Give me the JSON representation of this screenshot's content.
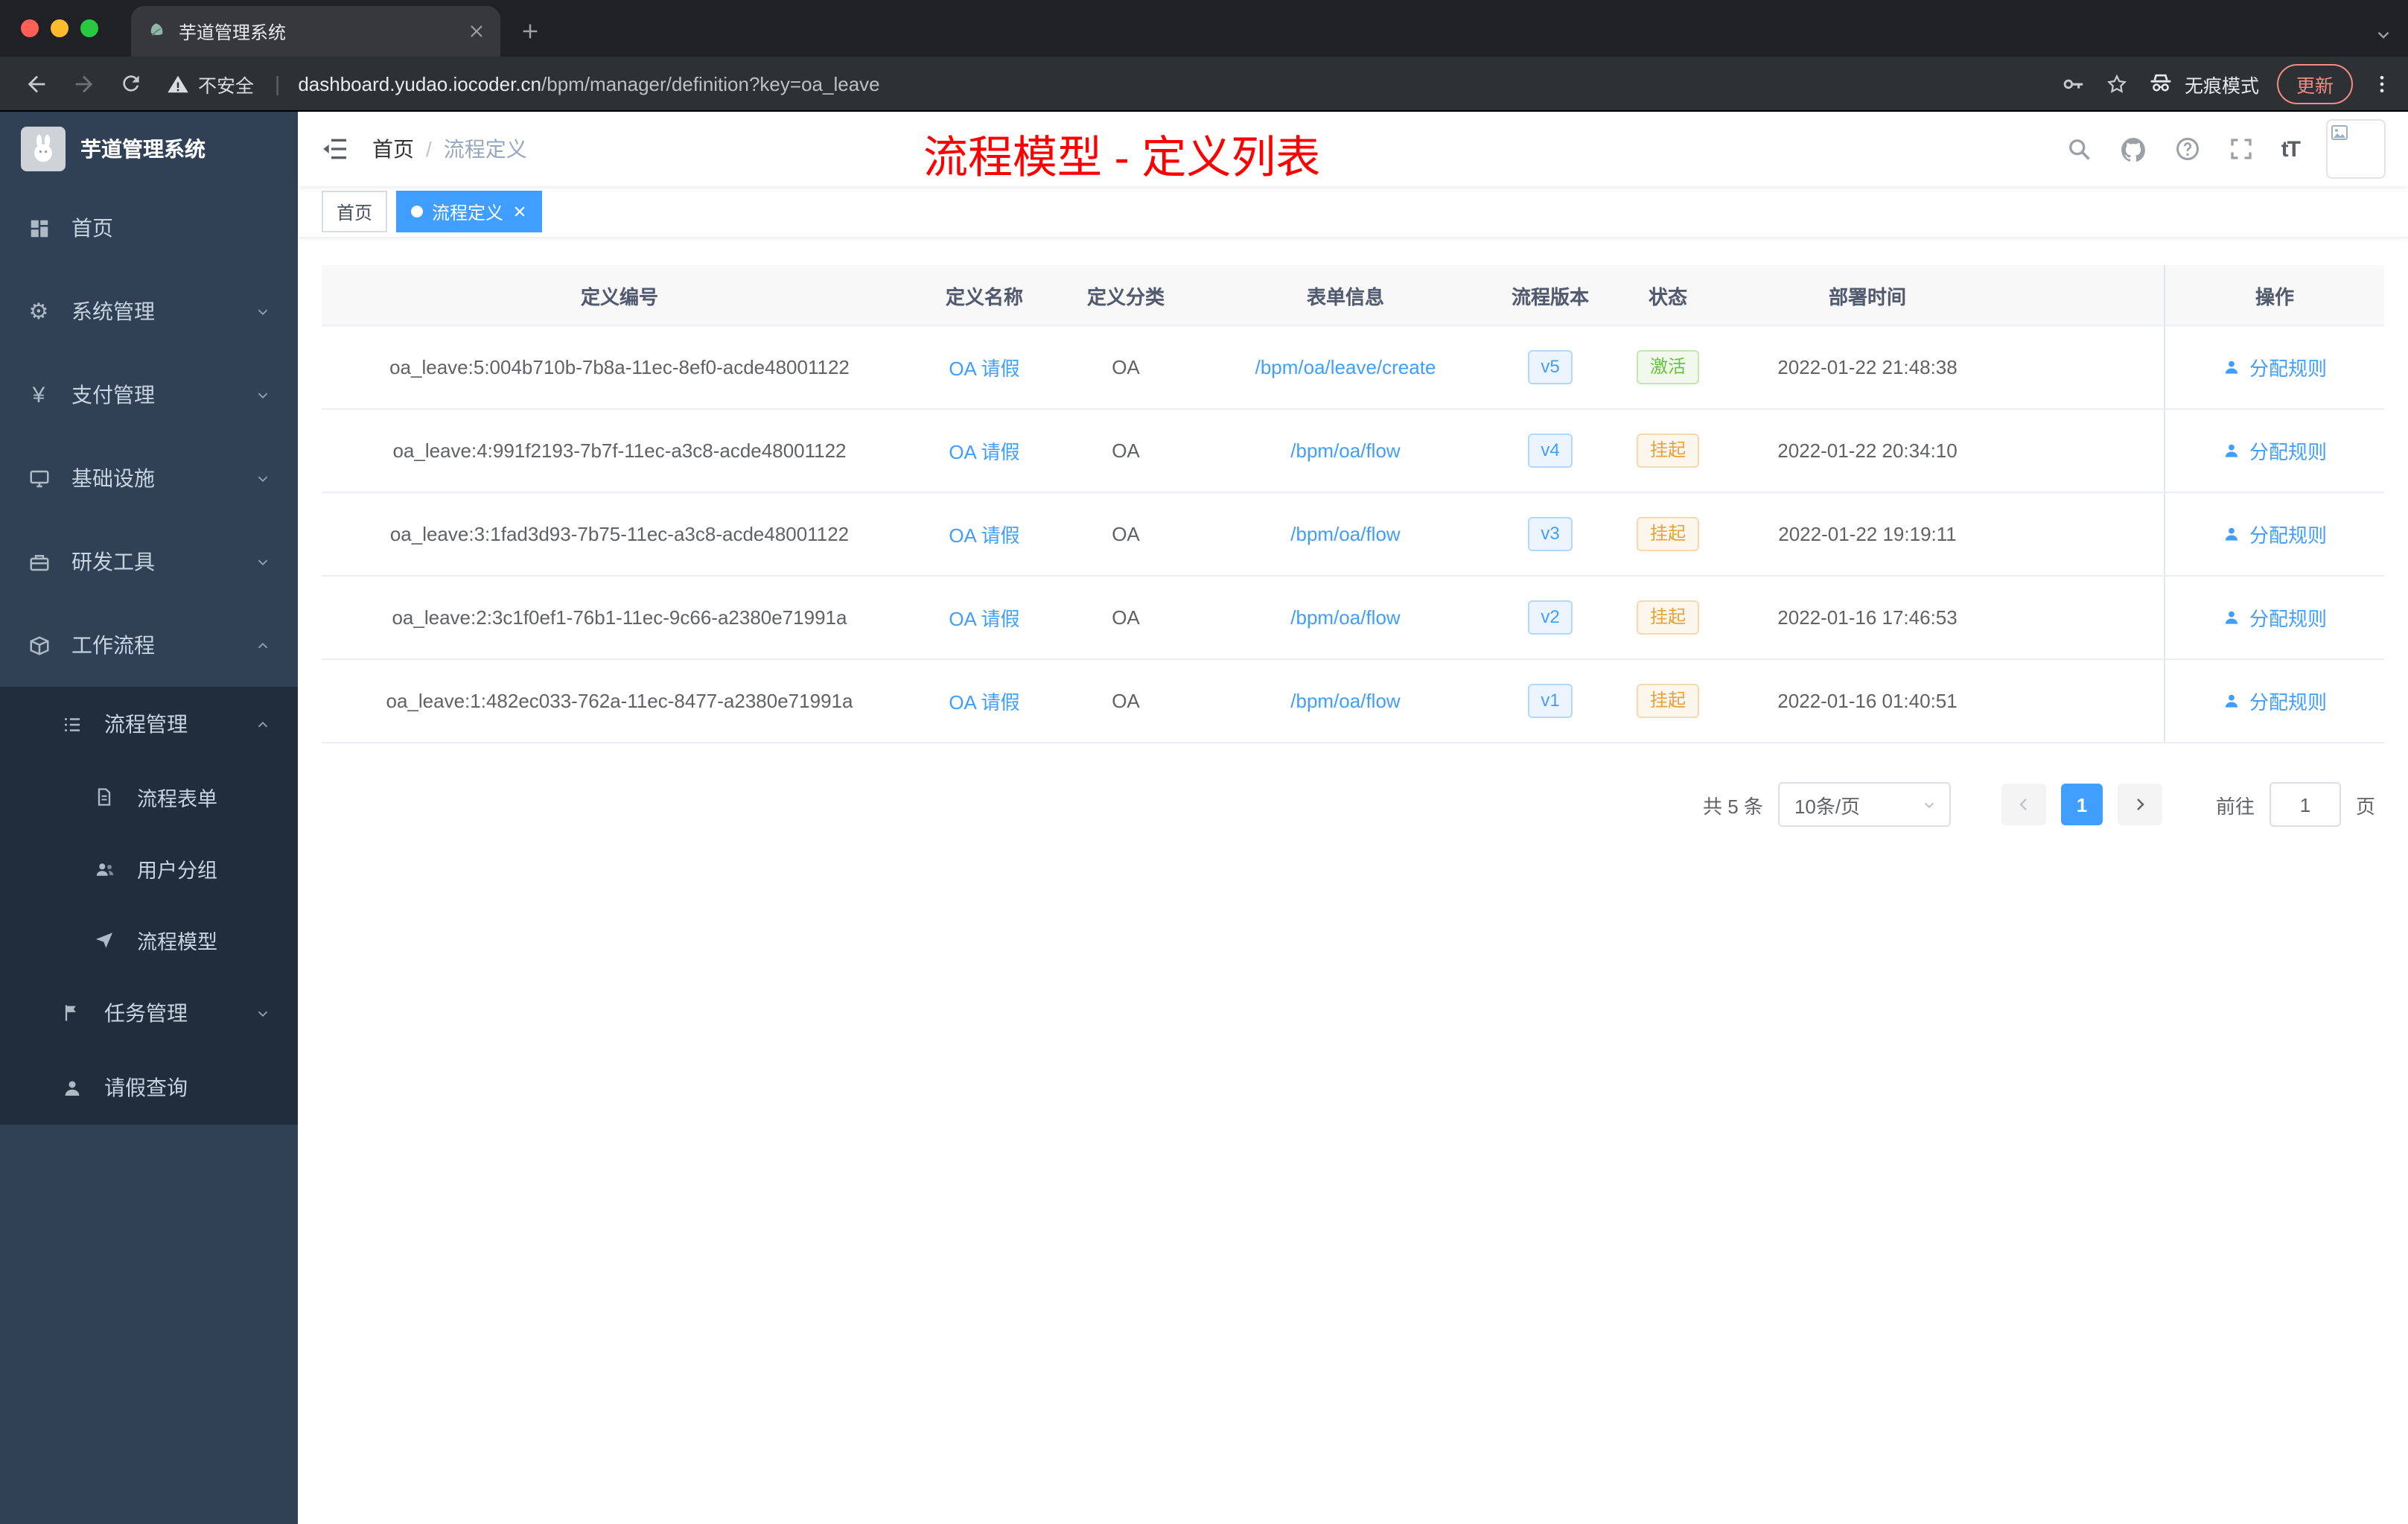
{
  "colors": {
    "accent": "#409eff",
    "success": "#67c23a",
    "warning": "#e6a23c",
    "annotation_red": "#fe0000",
    "sidebar_bg": "#304156",
    "submenu_bg": "#1f2d3d",
    "chrome_strip": "#202124",
    "toolbar_bg": "#2e3134",
    "tab_active_bg": "#36383b",
    "update_red": "#f28b82"
  },
  "browser": {
    "tab_title": "芋道管理系统",
    "security": "不安全",
    "url_domain": "dashboard.yudao.iocoder.cn",
    "url_path": "/bpm/manager/definition?key=oa_leave",
    "incognito": "无痕模式",
    "update": "更新"
  },
  "sidebar": {
    "logo_title": "芋道管理系统",
    "items": [
      {
        "label": "首页"
      },
      {
        "label": "系统管理",
        "icon_glyph": "⚙"
      },
      {
        "label": "支付管理",
        "icon_glyph": "¥"
      },
      {
        "label": "基础设施"
      },
      {
        "label": "研发工具"
      },
      {
        "label": "工作流程"
      }
    ],
    "submenu": {
      "process_mgmt": {
        "label": "流程管理",
        "children": [
          {
            "label": "流程表单"
          },
          {
            "label": "用户分组"
          },
          {
            "label": "流程模型"
          }
        ]
      },
      "task_mgmt": {
        "label": "任务管理"
      },
      "leave_query": {
        "label": "请假查询"
      }
    }
  },
  "header": {
    "breadcrumb": [
      "首页",
      "流程定义"
    ],
    "breadcrumb_separator": "/",
    "annotation": "流程模型 - 定义列表",
    "font_icon_label": "tT"
  },
  "tags": [
    {
      "label": "首页"
    },
    {
      "label": "流程定义",
      "active": true
    }
  ],
  "table": {
    "headers": [
      "定义编号",
      "定义名称",
      "定义分类",
      "表单信息",
      "流程版本",
      "状态",
      "部署时间",
      "操作"
    ],
    "rows": [
      {
        "id": "oa_leave:5:004b710b-7b8a-11ec-8ef0-acde48001122",
        "name": "OA 请假",
        "category": "OA",
        "form": "/bpm/oa/leave/create",
        "version": "v5",
        "status": "激活",
        "status_type": "success",
        "deployed_at": "2022-01-22 21:48:38",
        "action": "分配规则"
      },
      {
        "id": "oa_leave:4:991f2193-7b7f-11ec-a3c8-acde48001122",
        "name": "OA 请假",
        "category": "OA",
        "form": "/bpm/oa/flow",
        "version": "v4",
        "status": "挂起",
        "status_type": "warning",
        "deployed_at": "2022-01-22 20:34:10",
        "action": "分配规则"
      },
      {
        "id": "oa_leave:3:1fad3d93-7b75-11ec-a3c8-acde48001122",
        "name": "OA 请假",
        "category": "OA",
        "form": "/bpm/oa/flow",
        "version": "v3",
        "status": "挂起",
        "status_type": "warning",
        "deployed_at": "2022-01-22 19:19:11",
        "action": "分配规则"
      },
      {
        "id": "oa_leave:2:3c1f0ef1-76b1-11ec-9c66-a2380e71991a",
        "name": "OA 请假",
        "category": "OA",
        "form": "/bpm/oa/flow",
        "version": "v2",
        "status": "挂起",
        "status_type": "warning",
        "deployed_at": "2022-01-16 17:46:53",
        "action": "分配规则"
      },
      {
        "id": "oa_leave:1:482ec033-762a-11ec-8477-a2380e71991a",
        "name": "OA 请假",
        "category": "OA",
        "form": "/bpm/oa/flow",
        "version": "v1",
        "status": "挂起",
        "status_type": "warning",
        "deployed_at": "2022-01-16 01:40:51",
        "action": "分配规则"
      }
    ]
  },
  "pagination": {
    "total": "共 5 条",
    "page_size": "10条/页",
    "current_page": "1",
    "goto_label": "前往",
    "goto_value": "1",
    "page_unit": "页"
  }
}
